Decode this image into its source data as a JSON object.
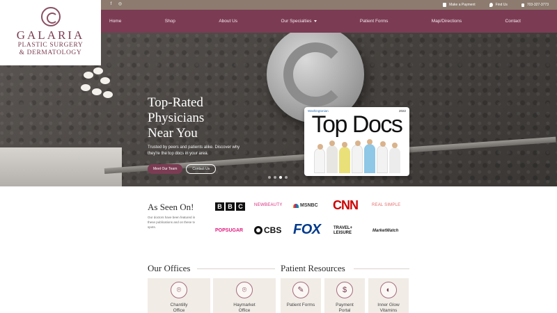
{
  "topbar": {
    "social": [
      "f",
      "◎"
    ],
    "make_payment": "Make a Payment",
    "find_us": "Find Us",
    "phone": "703-327-3773"
  },
  "logo": {
    "line1": "GALARIA",
    "line2": "PLASTIC SURGERY",
    "line3": "& DERMATOLOGY"
  },
  "nav": {
    "items": [
      "Home",
      "Shop",
      "About Us",
      "Our Specialties",
      "Patient Forms",
      "Map/Directions",
      "Contact"
    ]
  },
  "hero": {
    "title_lines": [
      "Top-Rated",
      "Physicians",
      "Near You"
    ],
    "subtitle": "Trusted by peers and patients alike. Discover why they're the top docs in your area.",
    "btn_primary": "Meet Our Team",
    "btn_secondary": "Contact Us",
    "magazine_brand": "Washingtonian",
    "magazine_year": "2022",
    "magazine_title": "Top Docs",
    "slides_total": 4,
    "active_slide": 3
  },
  "as_seen": {
    "title": "As Seen On!",
    "description": "Our doctors have been featured in these publications and on these tv spots.",
    "logos": {
      "bbc": [
        "B",
        "B",
        "C"
      ],
      "newbeauty": "NEWBEAUTY",
      "msnbc": "MSNBC",
      "cnn": "CNN",
      "realsimple": "REAL SIMPLE",
      "popsugar": "POPSUGAR",
      "cbs": "CBS",
      "fox": "FOX",
      "travel_l1": "TRAVEL+",
      "travel_l2": "LEISURE",
      "marketwatch": "MarketWatch"
    }
  },
  "offices": {
    "title": "Our Offices",
    "cards": [
      {
        "label_l1": "Chantilly",
        "label_l2": "Office",
        "icon": "map-pin-icon"
      },
      {
        "label_l1": "Haymarket",
        "label_l2": "Office",
        "icon": "map-pin-icon"
      }
    ]
  },
  "resources": {
    "title": "Patient Resources",
    "cards": [
      {
        "label_l1": "Patient Forms",
        "label_l2": "",
        "icon": "clipboard-icon"
      },
      {
        "label_l1": "Payment",
        "label_l2": "Portal",
        "icon": "payment-icon"
      },
      {
        "label_l1": "Inner Glow",
        "label_l2": "Vitamins",
        "icon": "vitamin-icon"
      }
    ]
  },
  "colors": {
    "brand": "#7b3c53",
    "topbar": "#8c7b6e",
    "card_bg": "#f1ece6"
  }
}
